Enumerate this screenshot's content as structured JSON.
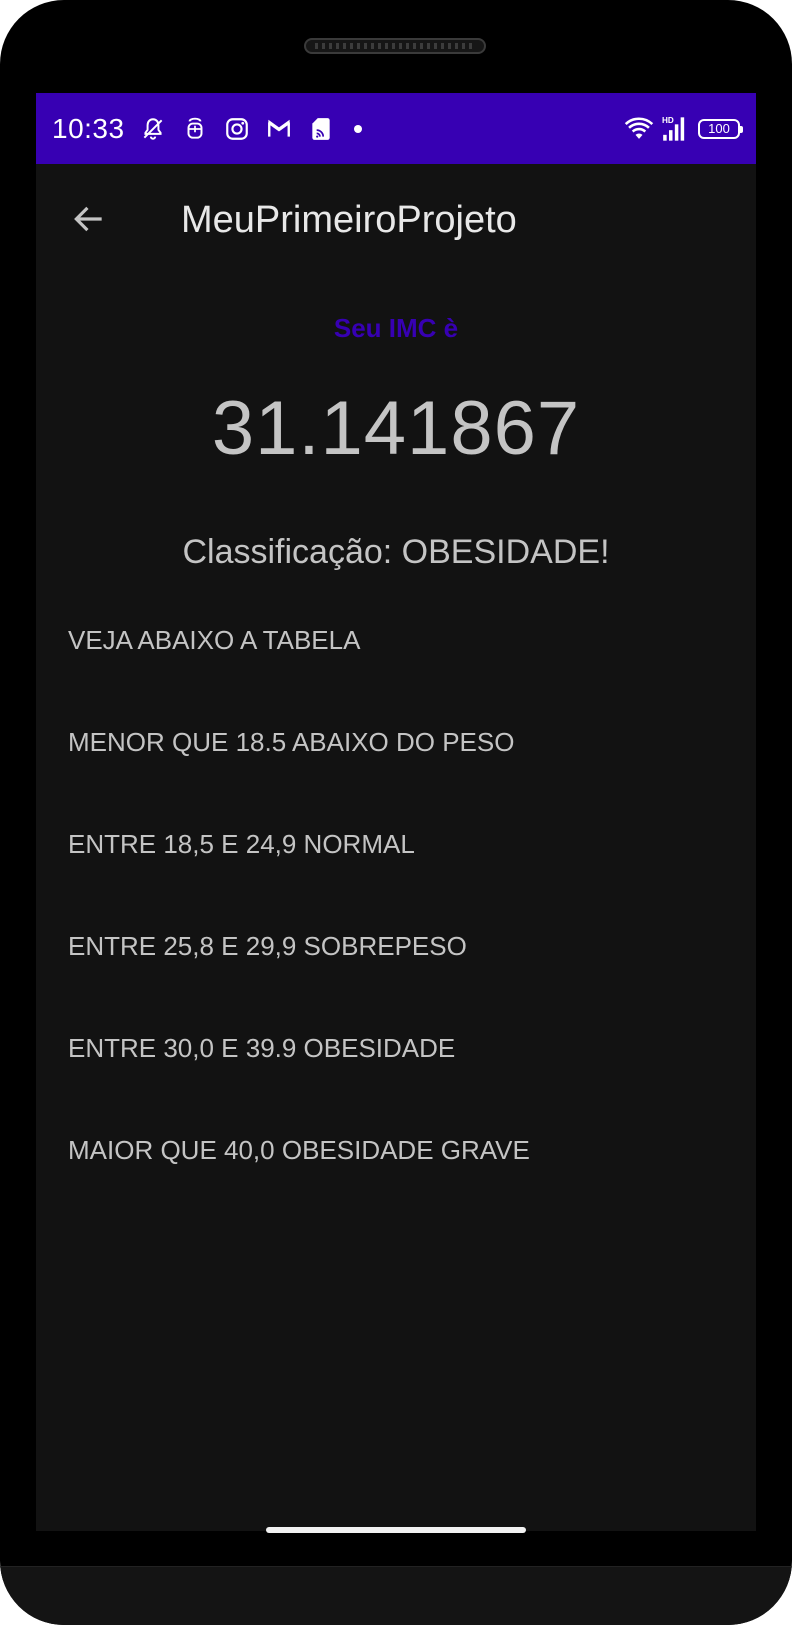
{
  "status_bar": {
    "time": "10:33",
    "battery_level": "100",
    "background_color": "#3700b3",
    "left_icons": [
      "do-not-disturb-bell-icon",
      "sim-toolkit-icon",
      "instagram-icon",
      "gmail-icon",
      "sd-card-icon",
      "notification-dot-icon"
    ],
    "right_icons": [
      "wifi-icon",
      "hd-signal-icon",
      "battery-icon"
    ]
  },
  "app_bar": {
    "title": "MeuPrimeiroProjeto",
    "back_icon": "arrow-back-icon"
  },
  "result": {
    "label": "Seu IMC è",
    "value": "31.141867",
    "classification": "Classificação: OBESIDADE!"
  },
  "table": {
    "lines": [
      "VEJA ABAIXO A TABELA",
      "MENOR QUE 18.5 ABAIXO DO PESO",
      "ENTRE 18,5 E 24,9 NORMAL",
      "ENTRE 25,8 E 29,9 SOBREPESO",
      "ENTRE 30,0 E 39.9 OBESIDADE",
      "MAIOR QUE 40,0 OBESIDADE GRAVE"
    ]
  },
  "colors": {
    "accent": "#3700b3",
    "screen_background": "#121212",
    "text": "#c4c4c4"
  }
}
